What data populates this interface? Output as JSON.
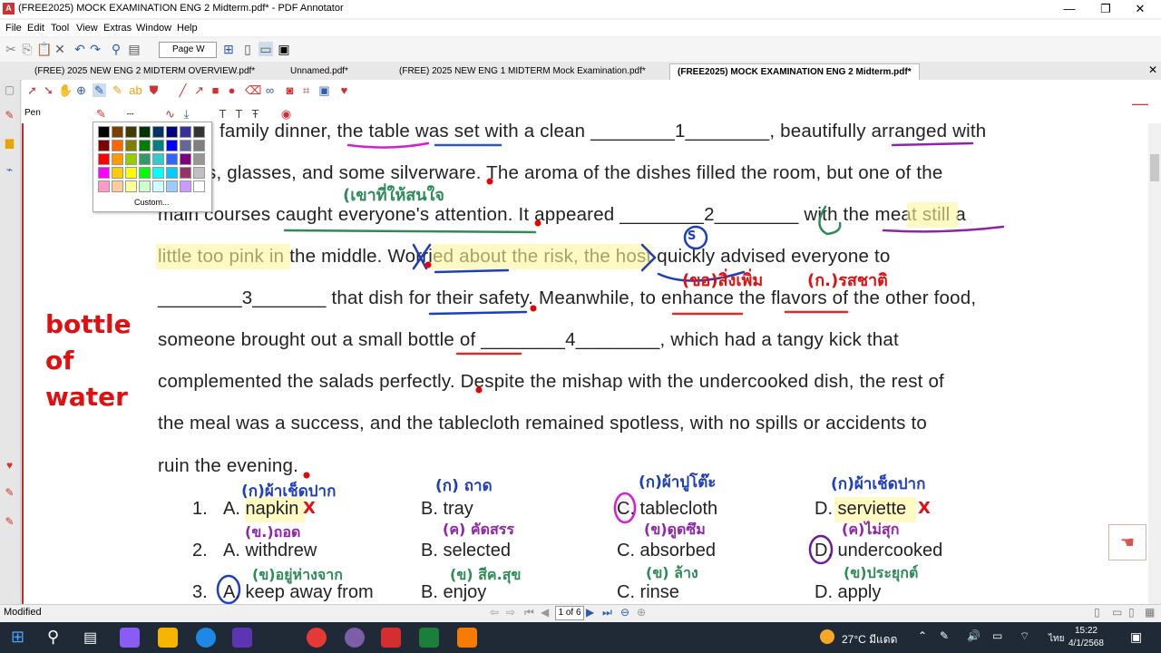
{
  "window": {
    "title": "(FREE2025) MOCK EXAMINATION ENG 2 Midterm.pdf* - PDF Annotator",
    "minimize": "—",
    "maximize": "❐",
    "close": "✕"
  },
  "menu": [
    "File",
    "Edit",
    "Tool",
    "View",
    "Extras",
    "Window",
    "Help"
  ],
  "toolbar": {
    "page_width": "Page W"
  },
  "tabs": [
    {
      "label": "(FREE) 2025 NEW ENG 2 MIDTERM OVERVIEW.pdf*",
      "active": false
    },
    {
      "label": "Unnamed.pdf*",
      "active": false
    },
    {
      "label": "(FREE) 2025 NEW ENG 1 MIDTERM Mock Examination.pdf*",
      "active": false
    },
    {
      "label": "(FREE2025) MOCK EXAMINATION ENG 2 Midterm.pdf*",
      "active": true
    }
  ],
  "annotation_tool": {
    "label": "Pen"
  },
  "palette": {
    "colors": [
      "#000000",
      "#7b3f00",
      "#3d3d00",
      "#003300",
      "#003366",
      "#000080",
      "#333399",
      "#333333",
      "#800000",
      "#ff6600",
      "#808000",
      "#008000",
      "#008080",
      "#0000ff",
      "#666699",
      "#808080",
      "#ff0000",
      "#ff9900",
      "#99cc00",
      "#339966",
      "#33cccc",
      "#3366ff",
      "#800080",
      "#969696",
      "#ff00ff",
      "#ffcc00",
      "#ffff00",
      "#00ff00",
      "#00ffff",
      "#00ccff",
      "#993366",
      "#c0c0c0",
      "#ff99cc",
      "#ffcc99",
      "#ffff99",
      "#ccffcc",
      "#ccffff",
      "#99ccff",
      "#cc99ff",
      "#ffffff"
    ],
    "custom_label": "Custom..."
  },
  "document": {
    "lines": [
      "family dinner, the table was set with a clean ________1________, beautifully arranged with",
      "s, glasses, and some silverware. The aroma of the dishes filled the room, but one of the",
      "main courses caught everyone's attention. It appeared ________2________ with the meat still a",
      "little too pink in the middle. Worried about the risk, the host quickly advised everyone to",
      "________3_______ that dish for their safety. Meanwhile, to enhance the flavors of the other food,",
      "someone brought out a small bottle of ________4________, which had a tangy kick that",
      "complemented the salads perfectly. Despite the mishap with the undercooked dish, the rest of",
      "the meal was a success, and the tablecloth remained spotless, with no spills or accidents to",
      "ruin the evening."
    ],
    "questions": [
      {
        "num": "1.",
        "a": "A. napkin",
        "b": "B. tray",
        "c": "C. tablecloth",
        "d": "D. serviette"
      },
      {
        "num": "2.",
        "a": "A. withdrew",
        "b": "B. selected",
        "c": "C. absorbed",
        "d": "D. undercooked"
      },
      {
        "num": "3.",
        "a": "A. keep away from",
        "b": "B. enjoy",
        "c": "C. rinse",
        "d": "D. apply"
      }
    ],
    "handwriting": {
      "side_note": "bottle of water",
      "note1": "(เขาที่ให้สนใจ",
      "note2": "(ขอ)สิ่งเพิ่ม",
      "note3": "(ก.)รสชาติ",
      "q1a": "(ก)ผ้าเช็ดปาก",
      "q1b": "(ก) ถาด",
      "q1c": "(ก)ผ้าปูโต๊ะ",
      "q1d": "(ก)ผ้าเช็ดปาก",
      "q2a": "(ข.)ถอด",
      "q2b": "(ค) คัดสรร",
      "q2c": "(ข)ดูดซึม",
      "q2d": "(ค)ไม่สุก",
      "q3a": "(ข)อยู่ห่างจาก",
      "q3b": "(ข) สีค.สุข",
      "q3c": "(ข) ล้าง",
      "q3d": "(ข)ประยุกต์",
      "mark_s": "S",
      "x_mark": "X"
    }
  },
  "status": {
    "text": "Modified",
    "page": "1 of 6"
  },
  "taskbar": {
    "weather": "27°C มีแดด",
    "lang": "ไทย",
    "time": "15:22",
    "date": "4/1/2568"
  }
}
